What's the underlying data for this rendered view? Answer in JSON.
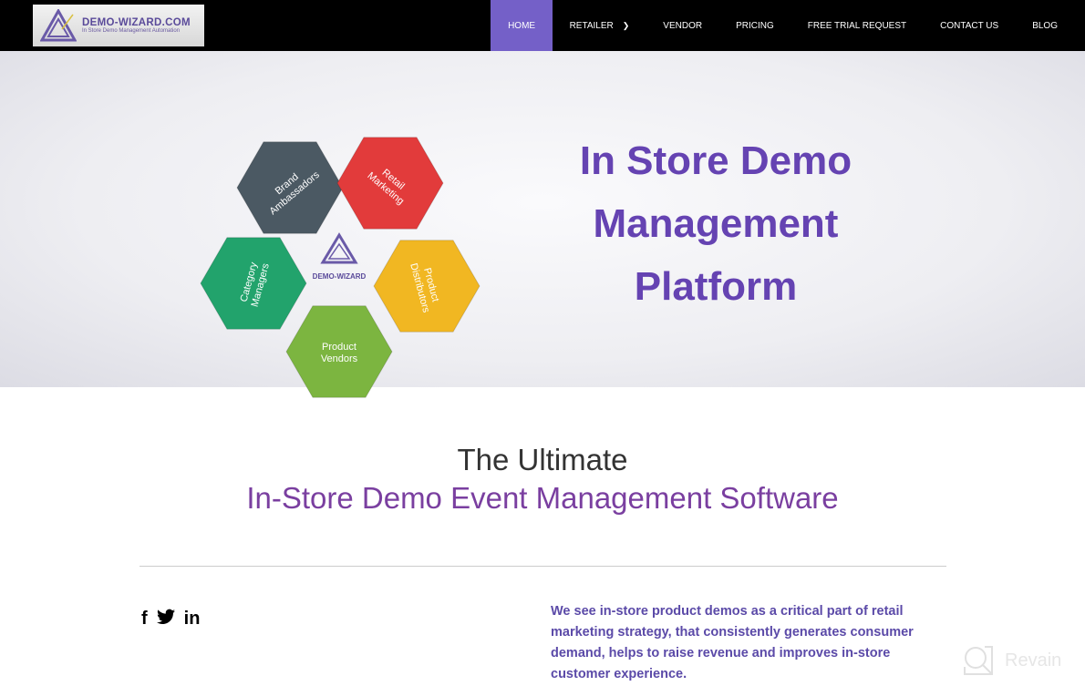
{
  "nav": {
    "logo": {
      "name": "DEMO-WIZARD.COM",
      "tagline": "In Store Demo Management Automation"
    },
    "items": [
      {
        "label": "HOME",
        "active": true
      },
      {
        "label": "RETAILER",
        "dropdown": true
      },
      {
        "label": "VENDOR"
      },
      {
        "label": "PRICING"
      },
      {
        "label": "FREE TRIAL REQUEST"
      },
      {
        "label": "CONTACT US"
      },
      {
        "label": "BLOG"
      }
    ],
    "active_color": "#7460c8"
  },
  "hero": {
    "title_lines": [
      "In Store Demo",
      "Management",
      "Platform"
    ],
    "puzzle": {
      "center_logo": "DEMO-WIZARD",
      "pieces": [
        {
          "label": [
            "Brand",
            "Ambassadors"
          ],
          "color": "#4b5963"
        },
        {
          "label": [
            "Retail",
            "Marketing"
          ],
          "color": "#e23b3b"
        },
        {
          "label": [
            "Product",
            "Distributors"
          ],
          "color": "#f1b722"
        },
        {
          "label": [
            "Product",
            "Vendors"
          ],
          "color": "#7cb540"
        },
        {
          "label": [
            "Category",
            "Managers"
          ],
          "color": "#22a36c"
        }
      ]
    }
  },
  "section": {
    "title_line1": "The Ultimate",
    "title_line2": "In-Store Demo Event Management Software",
    "social": [
      "facebook",
      "twitter",
      "linkedin"
    ],
    "social_glyphs": [
      "f",
      "🐦",
      "in"
    ],
    "paragraph": "We see in-store product demos as a critical part of retail marketing strategy, that consistently generates consumer demand, helps to raise revenue and improves in-store customer experience."
  },
  "watermark": "Revain"
}
